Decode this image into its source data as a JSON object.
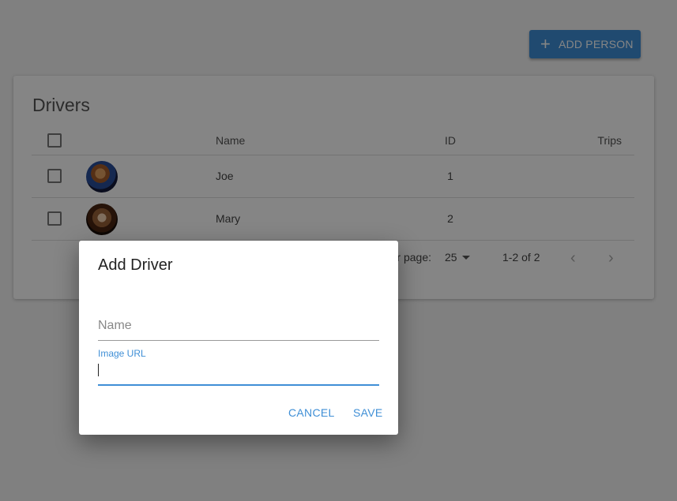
{
  "toolbar": {
    "add_person_label": "ADD PERSON",
    "add_icon": "plus-icon"
  },
  "card": {
    "title": "Drivers",
    "columns": [
      "Name",
      "ID",
      "Trips"
    ],
    "rows": [
      {
        "name": "Joe",
        "id": "1",
        "trips": "",
        "avatar": "avatar-joe"
      },
      {
        "name": "Mary",
        "id": "2",
        "trips": "",
        "avatar": "avatar-mary"
      }
    ],
    "pagination": {
      "rows_per_page_label": "Rows per page:",
      "rows_per_page_value": "25",
      "range": "1-2 of 2",
      "prev_icon": "chevron-left-icon",
      "next_icon": "chevron-right-icon"
    }
  },
  "dialog": {
    "title": "Add Driver",
    "name_placeholder": "Name",
    "image_url_label": "Image URL",
    "image_url_value": "",
    "cancel_label": "CANCEL",
    "save_label": "SAVE"
  },
  "colors": {
    "accent": "#3f8fd6",
    "overlay": "rgba(0,0,0,0.48)"
  }
}
